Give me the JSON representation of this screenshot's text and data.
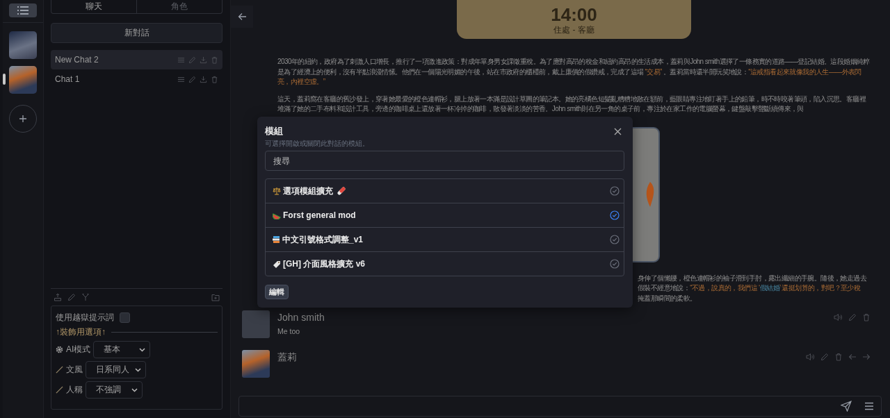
{
  "rail": {
    "avatars": [
      {
        "kind": "photo",
        "selected": false
      },
      {
        "kind": "photo",
        "selected": true
      }
    ]
  },
  "chat_panel": {
    "tabs": [
      {
        "label": "聊天",
        "selected": true
      },
      {
        "label": "角色",
        "selected": false
      }
    ],
    "new_chat": "新對話",
    "chats": [
      {
        "title": "New Chat 2",
        "selected": true
      },
      {
        "title": "Chat 1",
        "selected": false
      }
    ]
  },
  "settings": {
    "rows": [
      {
        "kind": "checkbox",
        "label": "使用越獄提示詞",
        "checked": false
      },
      {
        "kind": "divider",
        "label": "↑裝飾用選項↑"
      },
      {
        "kind": "select",
        "label": "AI模式",
        "value": "基本"
      },
      {
        "kind": "select",
        "label": "文風",
        "value": "日系同人"
      },
      {
        "kind": "select",
        "label": "人稱",
        "value": "不強調"
      }
    ]
  },
  "scene": {
    "time": "14:00",
    "location": "住處 - 客廳"
  },
  "story": {
    "paragraphs": [
      [
        {
          "kind": "plain",
          "text": "2030年的紐約，政府為了刺激人口增長，推行了一項激進政策：對成年單身男女課徵重稅。為了應對高昂的稅金和紐約高昂的生活成本，蓋莉與John smith選擇了一條務實的道路——登記結婚。這段婚姻純粹是為了經濟上的便利，沒有半點浪漫情愫。他們在一個陽光明媚的午後，站在市政府的櫃檯前，戴上廉價的假鑽戒，完成了這場 "
        },
        {
          "kind": "quote",
          "text": "“交易”"
        },
        {
          "kind": "plain",
          "text": " 。蓋莉當時還半開玩笑地說："
        },
        {
          "kind": "quote",
          "text": "“這戒指看起來就像我的人生——外表閃亮，內裡空虛。”"
        }
      ],
      [
        {
          "kind": "plain",
          "text": "這天，蓋莉窩在客廳的舊沙發上，穿著她最愛的橙色連帽衫，腿上放著一本滿是設計草圖的筆記本。她的亮橘色短髮亂糟糟地散在額前，藍眼睛專注地盯著手上的鉛筆，時不時咬著筆頭，陷入沉思。客廳裡堆滿了她的二手布料和設計工具，旁邊的咖啡桌上還放著一杯冷掉的咖啡，散發著淡淡的苦香。John smith則在另一角的桌子前，專注於在家工作的電腦螢幕，鍵盤敲擊聲斷續傳來，與"
        }
      ]
    ],
    "partial_lines": [
      [
        {
          "kind": "plain",
          "text": "身伸了個懶腰，橙色連帽衫的袖子滑到手肘，露出纖細的手腕。隨後，她走過去"
        }
      ],
      [
        {
          "kind": "plain",
          "text": "假裝不經意地說："
        },
        {
          "kind": "quote",
          "text": "“不過，說真的，我們這 ‘"
        },
        {
          "kind": "term",
          "text": "假結婚"
        },
        {
          "kind": "quote",
          "text": "’ 還挺划算的，對吧？至少稅"
        }
      ],
      [
        {
          "kind": "plain",
          "text": "掩蓋那瞬間的柔軟。"
        }
      ]
    ]
  },
  "messages": [
    {
      "name": "John smith",
      "text": "Me too"
    },
    {
      "name": "蓋莉"
    }
  ],
  "modal": {
    "title": "模組",
    "subtitle": "可選擇開啟或關閉此對話的模組。",
    "search": {
      "placeholder": "搜尋"
    },
    "mods": [
      {
        "name": "選項模組擴充",
        "enabled": false
      },
      {
        "name": "Forst general mod",
        "enabled": true
      },
      {
        "name": "中文引號格式調整_v1",
        "enabled": false
      },
      {
        "name": "[GH] 介面風格擴充 v6",
        "enabled": false
      }
    ],
    "edit_button": "編輯"
  }
}
